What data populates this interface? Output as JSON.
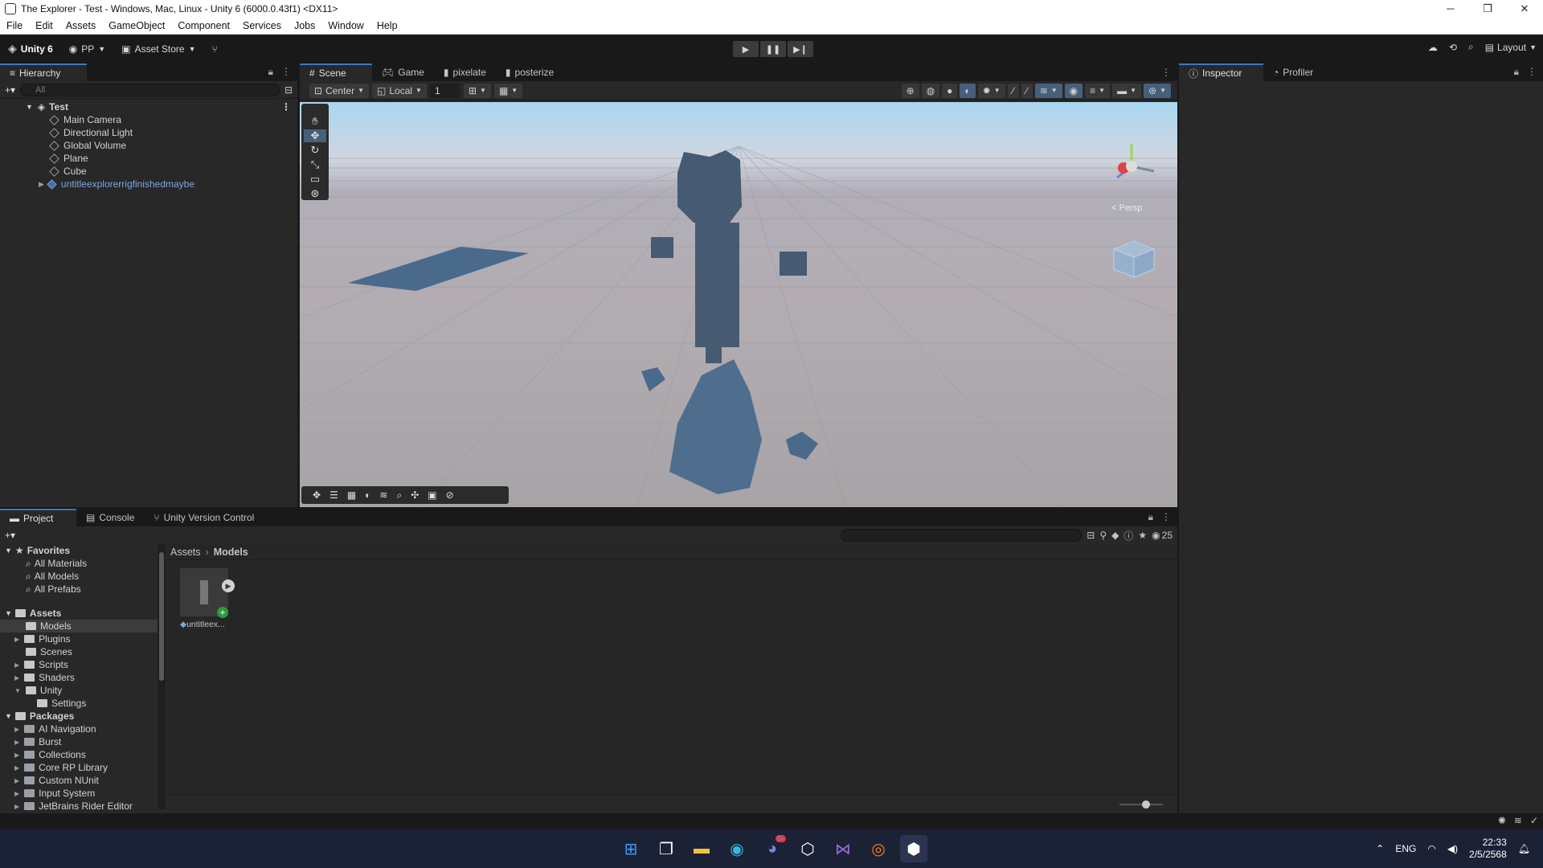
{
  "window": {
    "title": "The Explorer - Test - Windows, Mac, Linux - Unity 6 (6000.0.43f1) <DX11>",
    "controls": [
      "─",
      "❐",
      "✕"
    ]
  },
  "menu": [
    "File",
    "Edit",
    "Assets",
    "GameObject",
    "Component",
    "Services",
    "Jobs",
    "Window",
    "Help"
  ],
  "toolbar": {
    "account": "Unity 6",
    "pp": "PP",
    "asset_store": "Asset Store",
    "layout": "Layout"
  },
  "hierarchy": {
    "tab": "Hierarchy",
    "search_placeholder": "All",
    "scene": "Test",
    "items": [
      "Main Camera",
      "Directional Light",
      "Global Volume",
      "Plane",
      "Cube",
      "untitleexplorerrigfinishedmaybe"
    ]
  },
  "scene_tabs": [
    "Scene",
    "Game",
    "pixelate",
    "posterize"
  ],
  "scene_toolbar": {
    "pivot": "Center",
    "space": "Local",
    "snap": "1",
    "persp_label": "< Persp"
  },
  "inspector_tabs": [
    "Inspector",
    "Profiler"
  ],
  "project": {
    "tabs": [
      "Project",
      "Console",
      "Unity Version Control"
    ],
    "favorites_label": "Favorites",
    "favorites": [
      "All Materials",
      "All Models",
      "All Prefabs"
    ],
    "assets_label": "Assets",
    "assets": [
      "Models",
      "Plugins",
      "Scenes",
      "Scripts",
      "Shaders",
      "Unity",
      "Settings"
    ],
    "packages_label": "Packages",
    "packages": [
      "AI Navigation",
      "Burst",
      "Collections",
      "Core RP Library",
      "Custom NUnit",
      "Input System",
      "JetBrains Rider Editor"
    ],
    "breadcrumb": [
      "Assets",
      "Models"
    ],
    "asset_name": "untitleex...",
    "hidden_count": "25"
  },
  "taskbar": {
    "language": "ENG",
    "time": "22:33",
    "date": "2/5/2568",
    "discord_badge": "9+"
  },
  "colors": {
    "accent": "#3a79bb",
    "panel": "#282828",
    "dark": "#191919"
  }
}
